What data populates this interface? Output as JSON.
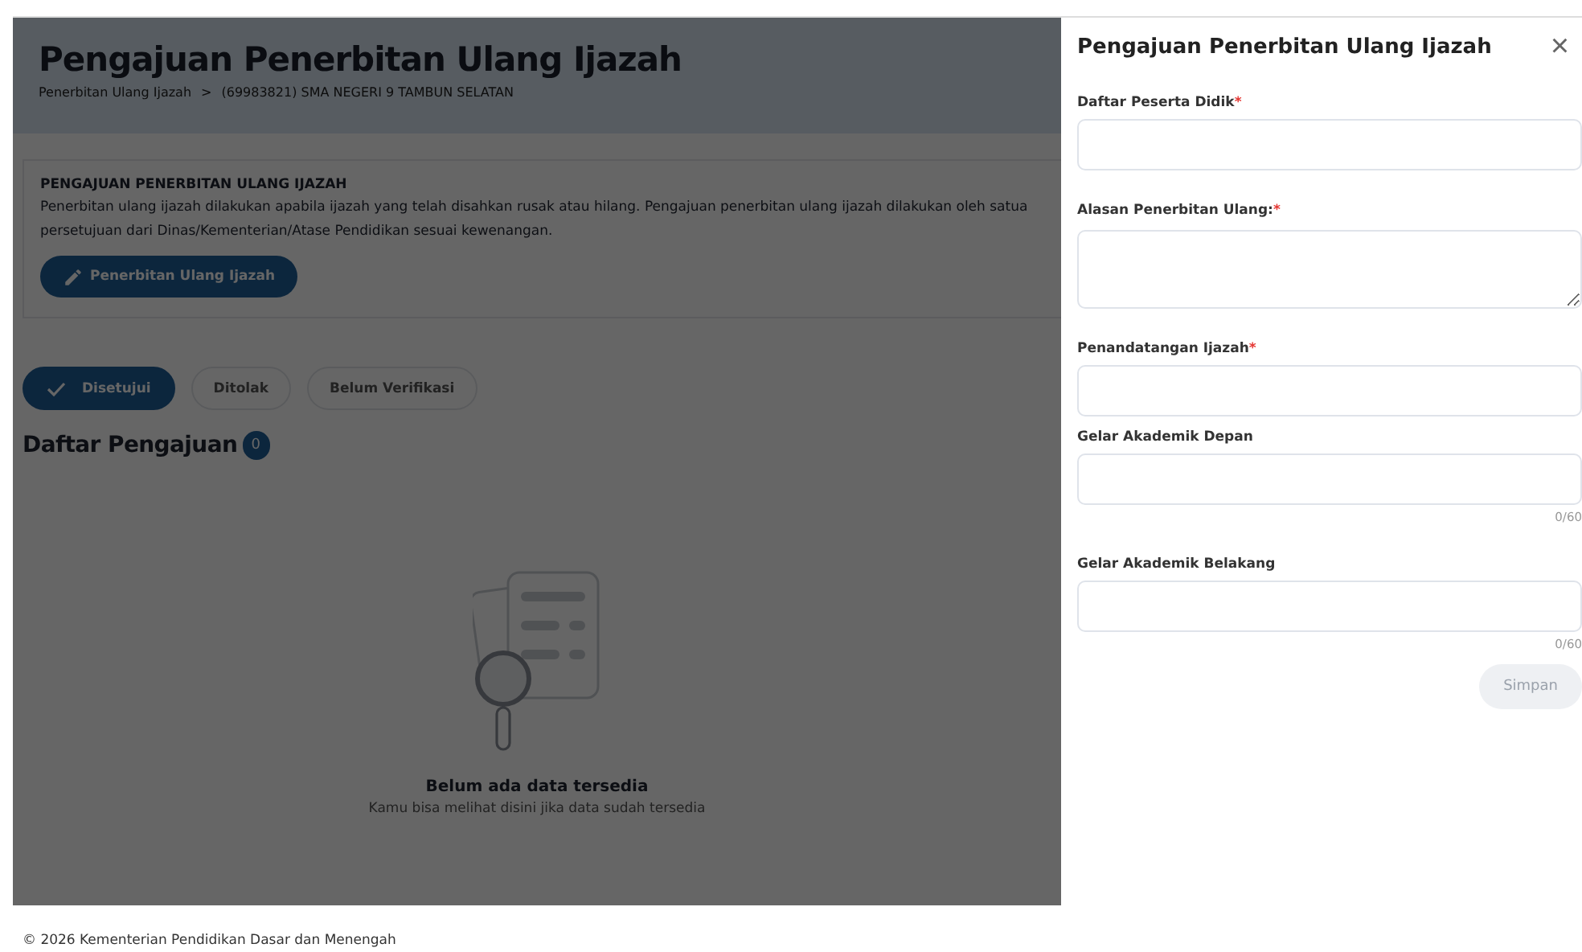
{
  "page": {
    "title": "Pengajuan Penerbitan Ulang Ijazah",
    "breadcrumb": [
      "Penerbitan Ulang Ijazah",
      "(69983821) SMA NEGERI 9 TAMBUN SELATAN"
    ],
    "breadcrumb_separator": ">"
  },
  "info": {
    "heading": "PENGAJUAN PENERBITAN ULANG IJAZAH",
    "lines": [
      "Penerbitan ulang ijazah dilakukan apabila ijazah yang telah disahkan rusak atau hilang. Pengajuan penerbitan ulang ijazah dilakukan oleh satua",
      "persetujuan dari Dinas/Kementerian/Atase Pendidikan sesuai kewenangan."
    ],
    "button": "Penerbitan Ulang Ijazah"
  },
  "tabs": [
    {
      "label": "Disetujui",
      "selected": true
    },
    {
      "label": "Ditolak",
      "selected": false
    },
    {
      "label": "Belum Verifikasi",
      "selected": false
    }
  ],
  "list": {
    "title": "Daftar Pengajuan",
    "count": "0",
    "empty_title": "Belum ada data tersedia",
    "empty_text": "Kamu bisa melihat disini jika data sudah tersedia"
  },
  "drawer": {
    "title": "Pengajuan Penerbitan Ulang Ijazah",
    "close": "×",
    "required_mark": "*",
    "fields": [
      {
        "label": "Daftar Peserta Didik",
        "required": true,
        "kind": "input"
      },
      {
        "label": "Alasan Penerbitan Ulang:",
        "required": true,
        "kind": "textarea"
      },
      {
        "label": "Penandatangan Ijazah",
        "required": true,
        "kind": "input"
      },
      {
        "label": "Gelar Akademik Depan",
        "required": false,
        "kind": "input",
        "counter": "0/60"
      },
      {
        "label": "Gelar Akademik Belakang",
        "required": false,
        "kind": "input",
        "counter": "0/60"
      }
    ],
    "submit": {
      "label": "Simpan",
      "disabled": true
    }
  },
  "footer": "© 2026 Kementerian Pendidikan Dasar dan Menengah"
}
